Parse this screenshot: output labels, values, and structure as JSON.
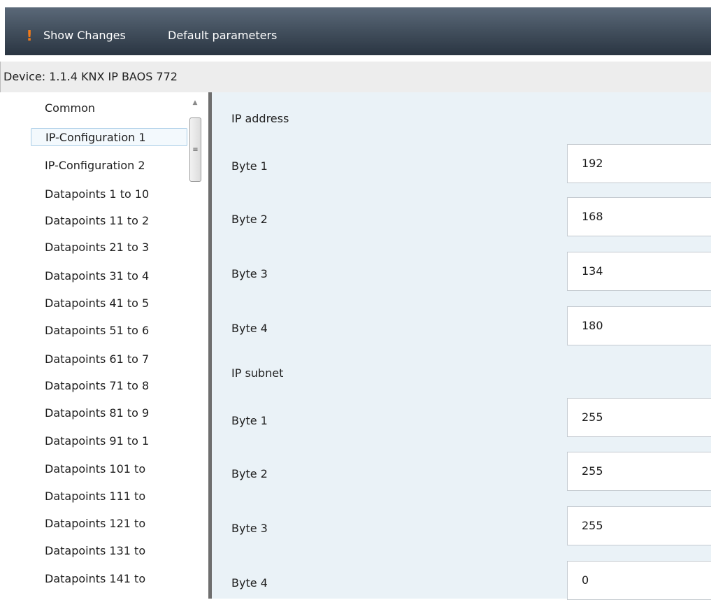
{
  "toolbar": {
    "warning_icon": "exclamation-icon",
    "warning_color": "#f07a1a",
    "show_changes_label": "Show Changes",
    "default_parameters_label": "Default parameters"
  },
  "device": {
    "label": "Device: 1.1.4  KNX IP BAOS 772"
  },
  "nav": {
    "items": [
      {
        "label": "Common"
      },
      {
        "label": "IP-Configuration 1",
        "selected": true
      },
      {
        "label": "IP-Configuration 2"
      },
      {
        "label": "Datapoints 1 to 10"
      },
      {
        "label": "Datapoints 11 to 2"
      },
      {
        "label": "Datapoints 21 to 3"
      },
      {
        "label": "Datapoints 31 to 4"
      },
      {
        "label": "Datapoints 41 to 5"
      },
      {
        "label": "Datapoints 51 to 6"
      },
      {
        "label": "Datapoints 61 to 7"
      },
      {
        "label": "Datapoints 71 to 8"
      },
      {
        "label": "Datapoints 81 to 9"
      },
      {
        "label": "Datapoints 91 to 1"
      },
      {
        "label": "Datapoints 101 to"
      },
      {
        "label": "Datapoints 111 to"
      },
      {
        "label": "Datapoints 121 to"
      },
      {
        "label": "Datapoints 131 to"
      },
      {
        "label": "Datapoints 141 to"
      }
    ]
  },
  "content": {
    "ip_address": {
      "title": "IP address",
      "fields": [
        {
          "label": "Byte 1",
          "value": "192"
        },
        {
          "label": "Byte 2",
          "value": "168"
        },
        {
          "label": "Byte 3",
          "value": "134"
        },
        {
          "label": "Byte 4",
          "value": "180"
        }
      ]
    },
    "ip_subnet": {
      "title": "IP subnet",
      "fields": [
        {
          "label": "Byte 1",
          "value": "255"
        },
        {
          "label": "Byte 2",
          "value": "255"
        },
        {
          "label": "Byte 3",
          "value": "255"
        },
        {
          "label": "Byte 4",
          "value": "0"
        }
      ]
    }
  }
}
